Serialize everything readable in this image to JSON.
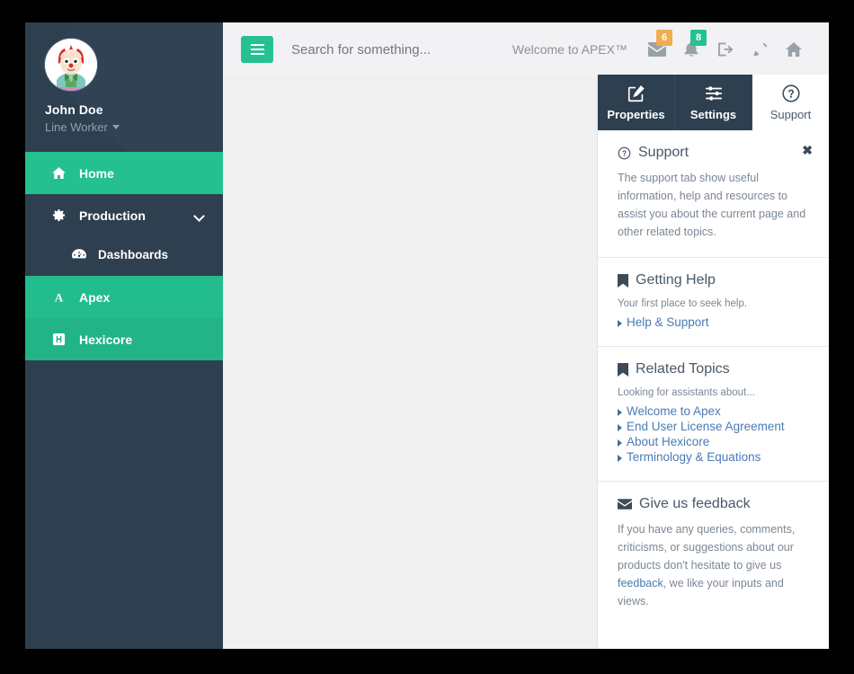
{
  "sidebar": {
    "profile": {
      "avatar_icon": "clown-avatar",
      "name": "John Doe",
      "role": "Line Worker"
    },
    "items": [
      {
        "label": "Home",
        "icon": "home-icon"
      },
      {
        "label": "Production",
        "icon": "gear-icon",
        "chevron": "chevron-down-icon"
      },
      {
        "label": "Dashboards",
        "icon": "dashboard-icon"
      },
      {
        "label": "Apex",
        "icon": "apex-a-icon"
      },
      {
        "label": "Hexicore",
        "icon": "hexicore-h-icon"
      }
    ]
  },
  "topbar": {
    "menu_toggle_icon": "hamburger-icon",
    "search_placeholder": "Search for something...",
    "search_value": "",
    "welcome_text": "Welcome to APEX™",
    "icons": [
      {
        "name": "mail-icon",
        "badge": "6",
        "badge_color": "#f0ad4e"
      },
      {
        "name": "bell-icon",
        "badge": "8",
        "badge_color": "#26c193"
      },
      {
        "name": "logout-icon",
        "badge": ""
      },
      {
        "name": "pencil-icon",
        "badge": ""
      },
      {
        "name": "home-icon",
        "badge": ""
      }
    ]
  },
  "right_panel": {
    "tabs": [
      {
        "label": "Properties",
        "icon": "edit-square-icon",
        "active": false
      },
      {
        "label": "Settings",
        "icon": "sliders-icon",
        "active": false
      },
      {
        "label": "Support",
        "icon": "question-circle-icon",
        "active": true
      }
    ],
    "close_label": "✖",
    "sections": {
      "support": {
        "title": "Support",
        "icon": "question-circle-icon",
        "body": "The support tab show useful information, help and resources to assist you about the current page and other related topics."
      },
      "getting_help": {
        "title": "Getting Help",
        "icon": "bookmark-icon",
        "body": "Your first place to seek help.",
        "links": [
          "Help & Support"
        ]
      },
      "related_topics": {
        "title": "Related Topics",
        "icon": "bookmark-icon",
        "body": "Looking for assistants about...",
        "links": [
          "Welcome to Apex",
          "End User License Agreement",
          "About Hexicore",
          "Terminology & Equations"
        ]
      },
      "feedback": {
        "title": "Give us feedback",
        "icon": "envelope-icon",
        "body_before": "If you have any queries, comments, criticisms, or suggestions about our products don't hesitate to give us ",
        "link": "feedback",
        "body_after": ", we like your inputs and views."
      }
    }
  },
  "colors": {
    "accent_teal": "#26c193",
    "sidebar_dark": "#2e3f50",
    "badge_orange": "#f0ad4e",
    "link_blue": "#4a7bb5"
  }
}
